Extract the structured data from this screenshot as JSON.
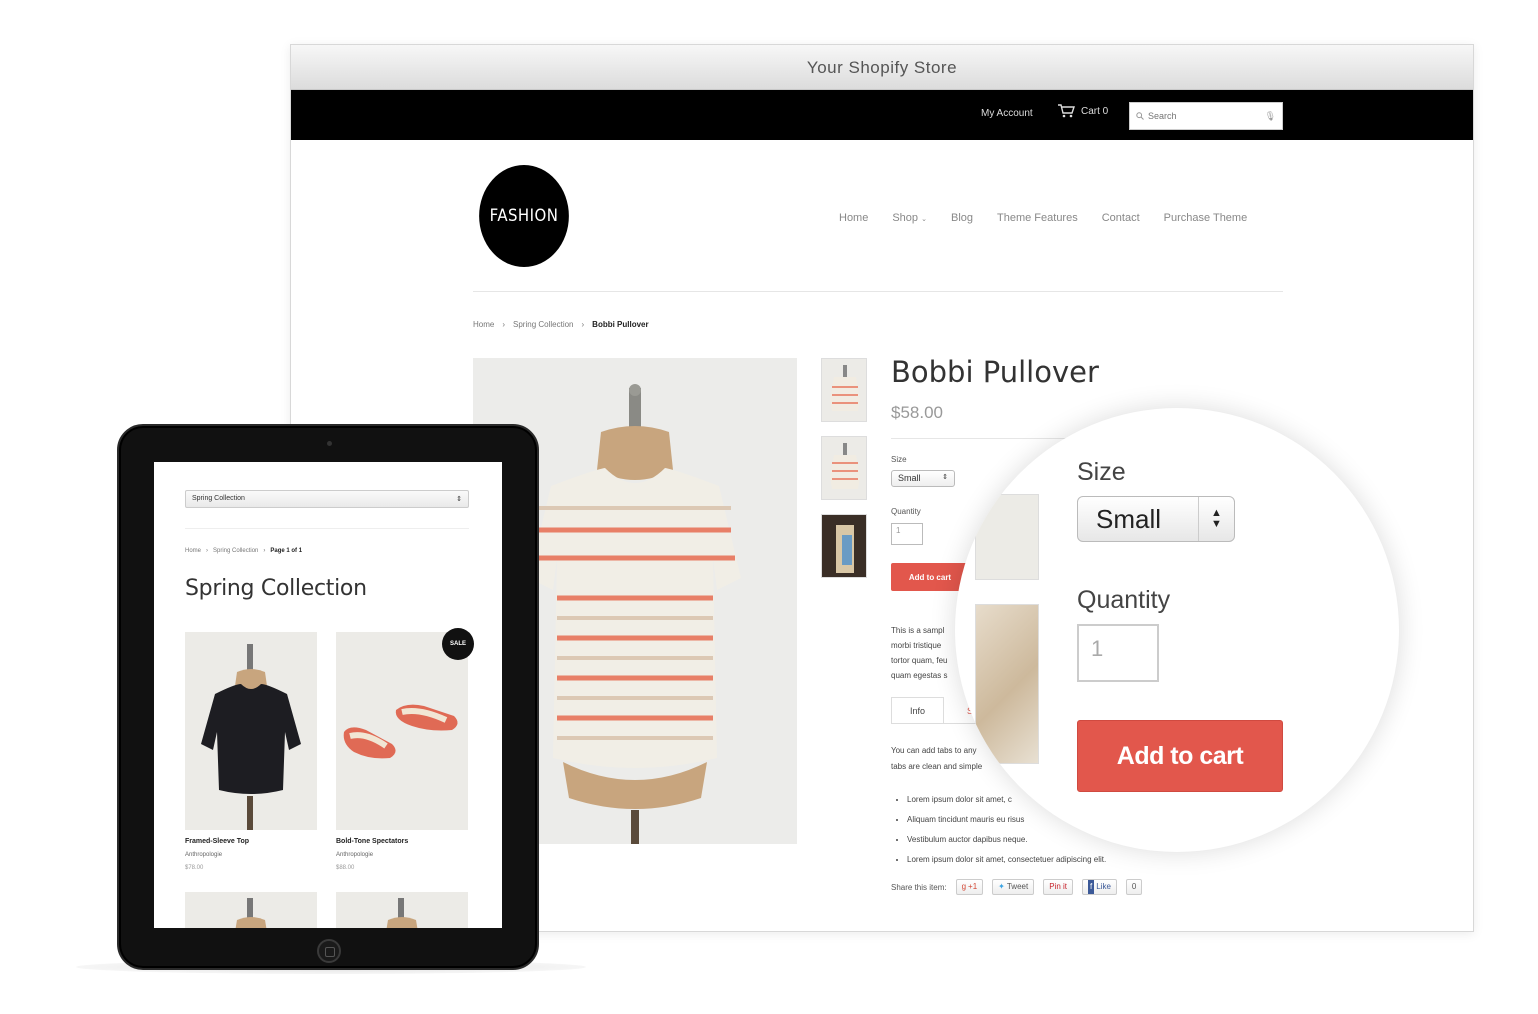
{
  "window": {
    "title": "Your Shopify Store"
  },
  "topbar": {
    "account": "My Account",
    "cart": "Cart 0",
    "search_placeholder": "Search"
  },
  "store": {
    "logo": "FASHION",
    "nav": [
      "Home",
      "Shop",
      "Blog",
      "Theme Features",
      "Contact",
      "Purchase Theme"
    ]
  },
  "breadcrumb": [
    "Home",
    "Spring Collection",
    "Bobbi Pullover"
  ],
  "product": {
    "title": "Bobbi Pullover",
    "price": "$58.00",
    "size_label": "Size",
    "size_value": "Small",
    "quantity_label": "Quantity",
    "quantity_value": "1",
    "add_to_cart": "Add to cart",
    "description_lines": [
      "This is a sampl",
      "morbi tristique",
      "tortor quam, feu",
      "quam egestas s"
    ],
    "tabs": [
      "Info",
      "Sp"
    ],
    "tab_text_lines": [
      "You can add tabs to any",
      "tabs are clean and simple"
    ],
    "bullets": [
      "Lorem ipsum dolor sit amet, c",
      "Aliquam tincidunt mauris eu risus",
      "Vestibulum auctor dapibus neque.",
      "Lorem ipsum dolor sit amet, consectetuer adipiscing elit."
    ],
    "share_label": "Share this item:",
    "share_buttons": [
      "+1",
      "Tweet",
      "Pin it",
      "Like",
      "0"
    ]
  },
  "magnifier": {
    "size_label": "Size",
    "size_value": "Small",
    "quantity_label": "Quantity",
    "quantity_value": "1",
    "add_to_cart": "Add to cart"
  },
  "tablet": {
    "collection_select": "Spring Collection",
    "breadcrumb": [
      "Home",
      "Spring Collection",
      "Page 1 of 1"
    ],
    "heading": "Spring Collection",
    "sale_badge": "SALE",
    "products": [
      {
        "name": "Framed-Sleeve Top",
        "brand": "Anthropologie",
        "price": "$78.00"
      },
      {
        "name": "Bold-Tone Spectators",
        "brand": "Anthropologie",
        "price": "$88.00"
      }
    ]
  },
  "colors": {
    "accent": "#e2574c",
    "topbar": "#000000",
    "logo_bg": "#000000"
  }
}
